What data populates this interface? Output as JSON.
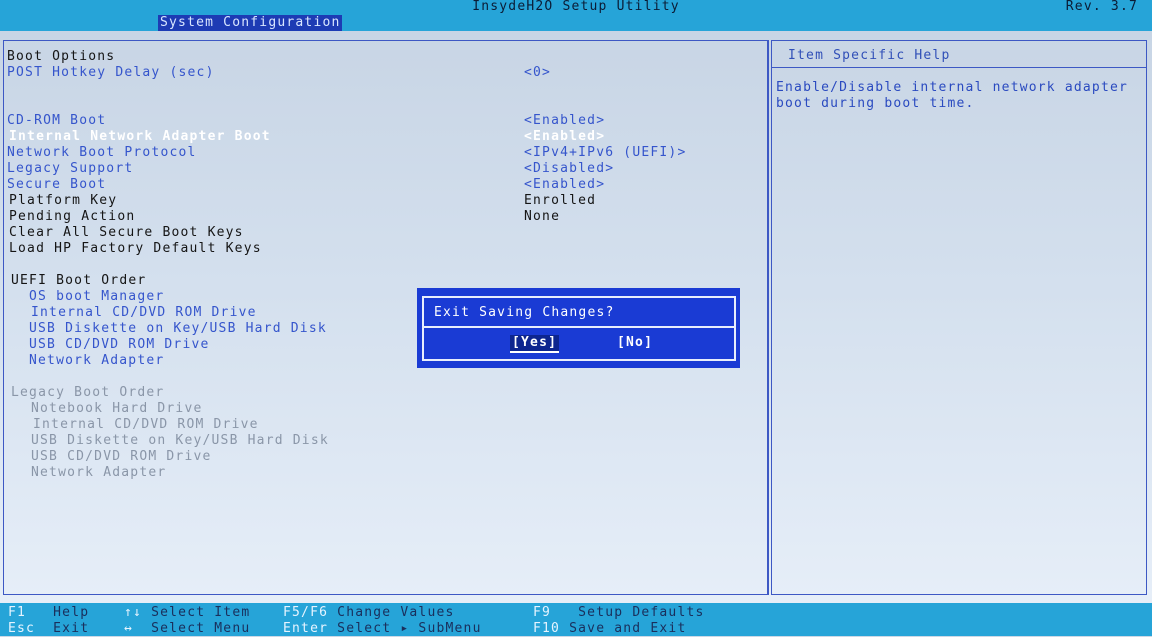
{
  "header": {
    "app_title": "InsydeH2O Setup Utility",
    "revision": "Rev. 3.7",
    "active_menu": "System Configuration"
  },
  "settings": {
    "boot_options_label": "Boot Options",
    "post_hotkey_delay": {
      "label": "POST Hotkey Delay (sec)",
      "value": "<0>"
    },
    "cdrom_boot": {
      "label": "CD-ROM Boot",
      "value": "<Enabled>"
    },
    "internal_network_adapter_boot": {
      "label": "Internal Network Adapter Boot",
      "value": "<Enabled>"
    },
    "network_boot_protocol": {
      "label": "Network Boot Protocol",
      "value": "<IPv4+IPv6 (UEFI)>"
    },
    "legacy_support": {
      "label": "Legacy Support",
      "value": "<Disabled>"
    },
    "secure_boot": {
      "label": "Secure Boot",
      "value": "<Enabled>"
    },
    "platform_key": {
      "label": "Platform Key",
      "value": "Enrolled"
    },
    "pending_action": {
      "label": "Pending Action",
      "value": "None"
    },
    "clear_secure_boot_keys": "Clear All Secure Boot Keys",
    "load_hp_default_keys": "Load HP Factory Default Keys",
    "uefi_boot_order_label": "UEFI Boot Order",
    "uefi_items": [
      "OS boot Manager",
      "Internal CD/DVD ROM Drive",
      "USB Diskette on Key/USB Hard Disk",
      "USB CD/DVD ROM Drive",
      "Network Adapter"
    ],
    "legacy_boot_order_label": "Legacy Boot Order",
    "legacy_items": [
      "Notebook Hard Drive",
      "Internal CD/DVD ROM Drive",
      "USB Diskette on Key/USB Hard Disk",
      "USB CD/DVD ROM Drive",
      "Network Adapter"
    ]
  },
  "help": {
    "title": "Item Specific Help",
    "line1": "Enable/Disable internal network adapter",
    "line2": "boot during boot time."
  },
  "dialog": {
    "message": "Exit Saving Changes?",
    "yes_label": "[Yes]",
    "no_label": "[No]"
  },
  "footer": {
    "f1_key": "F1",
    "f1_desc": "Help",
    "esc_key": "Esc",
    "esc_desc": "Exit",
    "updown_key": "↑↓",
    "updown_desc": "Select Item",
    "leftright_key": "↔",
    "leftright_desc": "Select Menu",
    "f5f6_key": "F5/F6",
    "f5f6_desc": "Change Values",
    "enter_key": "Enter",
    "enter_desc": "Select ▸ SubMenu",
    "f9_key": "F9",
    "f9_desc": "Setup Defaults",
    "f10_key": "F10",
    "f10_desc": "Save and Exit"
  },
  "colors": {
    "bar": "#26a4d8",
    "background": "#ccd8e6",
    "dialog": "#1a3bd4",
    "link": "#3555cc"
  }
}
